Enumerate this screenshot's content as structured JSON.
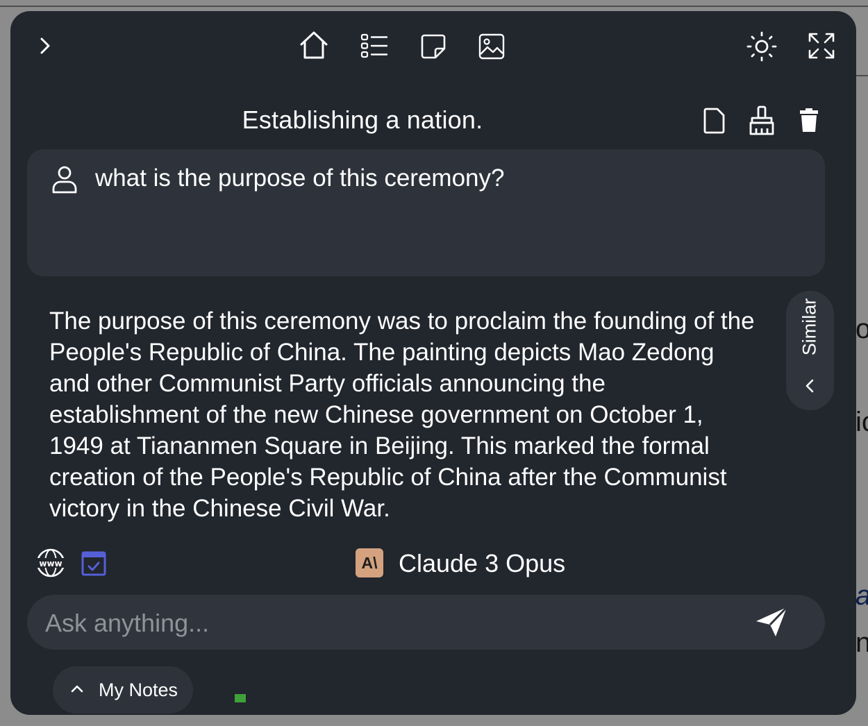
{
  "background": {
    "fragments": [
      "o",
      "ic",
      "a",
      "n"
    ]
  },
  "toolbar": {
    "expand_sidebar_icon": "chevron-right-icon",
    "home_icon": "home-icon",
    "list_icon": "list-icon",
    "note_icon": "sticky-note-icon",
    "image_icon": "image-icon",
    "theme_icon": "sun-icon",
    "fullscreen_icon": "expand-icon"
  },
  "chat": {
    "title": "Establishing a nation.",
    "actions": [
      "new-document-icon",
      "clear-broom-icon",
      "trash-icon"
    ],
    "question": "what is the purpose of this ceremony?",
    "answer_lines": [
      "The purpose of this ceremony was to proclaim the founding of the",
      "People's Republic of China. The painting depicts Mao Zedong",
      "and other Communist Party officials announcing the",
      "establishment of the new Chinese government on October 1,",
      "1949 at Tiananmen Square in Beijing. This marked the formal",
      "creation of the People's Republic of China after the Communist",
      "victory in the Chinese Civil War."
    ]
  },
  "similar_tab": {
    "label": "Similar"
  },
  "model": {
    "logo_text": "A\\",
    "name": "Claude 3 Opus",
    "logo_color": "#d4a27f"
  },
  "input": {
    "placeholder": "Ask anything...",
    "value": ""
  },
  "notes": {
    "label": "My Notes"
  },
  "colors": {
    "panel": "#22262d",
    "card": "#2e333b",
    "accent_calendar": "#5560d8",
    "status_green": "#3fa13a"
  }
}
